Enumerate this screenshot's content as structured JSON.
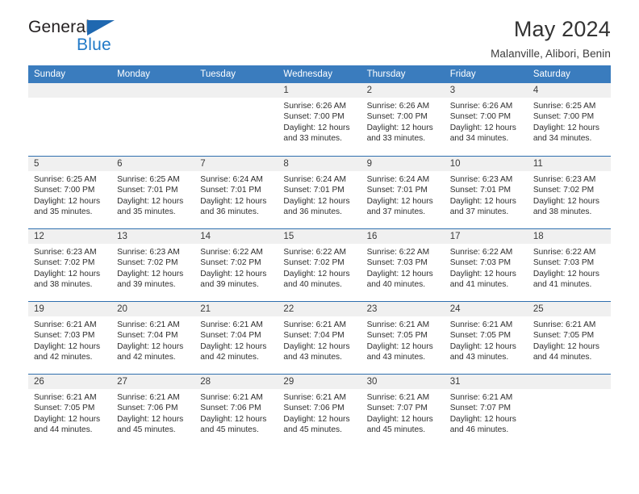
{
  "logo": {
    "word_one": "General",
    "word_two": "Blue",
    "triangle_color": "#1f68b0",
    "blue_color": "#2079c7"
  },
  "header": {
    "title": "May 2024",
    "subtitle": "Malanville, Alibori, Benin"
  },
  "calendar": {
    "header_bg": "#3a7cbe",
    "row_divider": "#2f6fae",
    "daynum_bg": "#f0f0f0",
    "weekdays": [
      "Sunday",
      "Monday",
      "Tuesday",
      "Wednesday",
      "Thursday",
      "Friday",
      "Saturday"
    ],
    "weeks": [
      [
        {
          "day": "",
          "blank": true
        },
        {
          "day": "",
          "blank": true
        },
        {
          "day": "",
          "blank": true
        },
        {
          "day": "1",
          "sunrise": "Sunrise: 6:26 AM",
          "sunset": "Sunset: 7:00 PM",
          "daylight_line1": "Daylight: 12 hours",
          "daylight_line2": "and 33 minutes."
        },
        {
          "day": "2",
          "sunrise": "Sunrise: 6:26 AM",
          "sunset": "Sunset: 7:00 PM",
          "daylight_line1": "Daylight: 12 hours",
          "daylight_line2": "and 33 minutes."
        },
        {
          "day": "3",
          "sunrise": "Sunrise: 6:26 AM",
          "sunset": "Sunset: 7:00 PM",
          "daylight_line1": "Daylight: 12 hours",
          "daylight_line2": "and 34 minutes."
        },
        {
          "day": "4",
          "sunrise": "Sunrise: 6:25 AM",
          "sunset": "Sunset: 7:00 PM",
          "daylight_line1": "Daylight: 12 hours",
          "daylight_line2": "and 34 minutes."
        }
      ],
      [
        {
          "day": "5",
          "sunrise": "Sunrise: 6:25 AM",
          "sunset": "Sunset: 7:00 PM",
          "daylight_line1": "Daylight: 12 hours",
          "daylight_line2": "and 35 minutes."
        },
        {
          "day": "6",
          "sunrise": "Sunrise: 6:25 AM",
          "sunset": "Sunset: 7:01 PM",
          "daylight_line1": "Daylight: 12 hours",
          "daylight_line2": "and 35 minutes."
        },
        {
          "day": "7",
          "sunrise": "Sunrise: 6:24 AM",
          "sunset": "Sunset: 7:01 PM",
          "daylight_line1": "Daylight: 12 hours",
          "daylight_line2": "and 36 minutes."
        },
        {
          "day": "8",
          "sunrise": "Sunrise: 6:24 AM",
          "sunset": "Sunset: 7:01 PM",
          "daylight_line1": "Daylight: 12 hours",
          "daylight_line2": "and 36 minutes."
        },
        {
          "day": "9",
          "sunrise": "Sunrise: 6:24 AM",
          "sunset": "Sunset: 7:01 PM",
          "daylight_line1": "Daylight: 12 hours",
          "daylight_line2": "and 37 minutes."
        },
        {
          "day": "10",
          "sunrise": "Sunrise: 6:23 AM",
          "sunset": "Sunset: 7:01 PM",
          "daylight_line1": "Daylight: 12 hours",
          "daylight_line2": "and 37 minutes."
        },
        {
          "day": "11",
          "sunrise": "Sunrise: 6:23 AM",
          "sunset": "Sunset: 7:02 PM",
          "daylight_line1": "Daylight: 12 hours",
          "daylight_line2": "and 38 minutes."
        }
      ],
      [
        {
          "day": "12",
          "sunrise": "Sunrise: 6:23 AM",
          "sunset": "Sunset: 7:02 PM",
          "daylight_line1": "Daylight: 12 hours",
          "daylight_line2": "and 38 minutes."
        },
        {
          "day": "13",
          "sunrise": "Sunrise: 6:23 AM",
          "sunset": "Sunset: 7:02 PM",
          "daylight_line1": "Daylight: 12 hours",
          "daylight_line2": "and 39 minutes."
        },
        {
          "day": "14",
          "sunrise": "Sunrise: 6:22 AM",
          "sunset": "Sunset: 7:02 PM",
          "daylight_line1": "Daylight: 12 hours",
          "daylight_line2": "and 39 minutes."
        },
        {
          "day": "15",
          "sunrise": "Sunrise: 6:22 AM",
          "sunset": "Sunset: 7:02 PM",
          "daylight_line1": "Daylight: 12 hours",
          "daylight_line2": "and 40 minutes."
        },
        {
          "day": "16",
          "sunrise": "Sunrise: 6:22 AM",
          "sunset": "Sunset: 7:03 PM",
          "daylight_line1": "Daylight: 12 hours",
          "daylight_line2": "and 40 minutes."
        },
        {
          "day": "17",
          "sunrise": "Sunrise: 6:22 AM",
          "sunset": "Sunset: 7:03 PM",
          "daylight_line1": "Daylight: 12 hours",
          "daylight_line2": "and 41 minutes."
        },
        {
          "day": "18",
          "sunrise": "Sunrise: 6:22 AM",
          "sunset": "Sunset: 7:03 PM",
          "daylight_line1": "Daylight: 12 hours",
          "daylight_line2": "and 41 minutes."
        }
      ],
      [
        {
          "day": "19",
          "sunrise": "Sunrise: 6:21 AM",
          "sunset": "Sunset: 7:03 PM",
          "daylight_line1": "Daylight: 12 hours",
          "daylight_line2": "and 42 minutes."
        },
        {
          "day": "20",
          "sunrise": "Sunrise: 6:21 AM",
          "sunset": "Sunset: 7:04 PM",
          "daylight_line1": "Daylight: 12 hours",
          "daylight_line2": "and 42 minutes."
        },
        {
          "day": "21",
          "sunrise": "Sunrise: 6:21 AM",
          "sunset": "Sunset: 7:04 PM",
          "daylight_line1": "Daylight: 12 hours",
          "daylight_line2": "and 42 minutes."
        },
        {
          "day": "22",
          "sunrise": "Sunrise: 6:21 AM",
          "sunset": "Sunset: 7:04 PM",
          "daylight_line1": "Daylight: 12 hours",
          "daylight_line2": "and 43 minutes."
        },
        {
          "day": "23",
          "sunrise": "Sunrise: 6:21 AM",
          "sunset": "Sunset: 7:05 PM",
          "daylight_line1": "Daylight: 12 hours",
          "daylight_line2": "and 43 minutes."
        },
        {
          "day": "24",
          "sunrise": "Sunrise: 6:21 AM",
          "sunset": "Sunset: 7:05 PM",
          "daylight_line1": "Daylight: 12 hours",
          "daylight_line2": "and 43 minutes."
        },
        {
          "day": "25",
          "sunrise": "Sunrise: 6:21 AM",
          "sunset": "Sunset: 7:05 PM",
          "daylight_line1": "Daylight: 12 hours",
          "daylight_line2": "and 44 minutes."
        }
      ],
      [
        {
          "day": "26",
          "sunrise": "Sunrise: 6:21 AM",
          "sunset": "Sunset: 7:05 PM",
          "daylight_line1": "Daylight: 12 hours",
          "daylight_line2": "and 44 minutes."
        },
        {
          "day": "27",
          "sunrise": "Sunrise: 6:21 AM",
          "sunset": "Sunset: 7:06 PM",
          "daylight_line1": "Daylight: 12 hours",
          "daylight_line2": "and 45 minutes."
        },
        {
          "day": "28",
          "sunrise": "Sunrise: 6:21 AM",
          "sunset": "Sunset: 7:06 PM",
          "daylight_line1": "Daylight: 12 hours",
          "daylight_line2": "and 45 minutes."
        },
        {
          "day": "29",
          "sunrise": "Sunrise: 6:21 AM",
          "sunset": "Sunset: 7:06 PM",
          "daylight_line1": "Daylight: 12 hours",
          "daylight_line2": "and 45 minutes."
        },
        {
          "day": "30",
          "sunrise": "Sunrise: 6:21 AM",
          "sunset": "Sunset: 7:07 PM",
          "daylight_line1": "Daylight: 12 hours",
          "daylight_line2": "and 45 minutes."
        },
        {
          "day": "31",
          "sunrise": "Sunrise: 6:21 AM",
          "sunset": "Sunset: 7:07 PM",
          "daylight_line1": "Daylight: 12 hours",
          "daylight_line2": "and 46 minutes."
        },
        {
          "day": "",
          "blank": true
        }
      ]
    ]
  }
}
